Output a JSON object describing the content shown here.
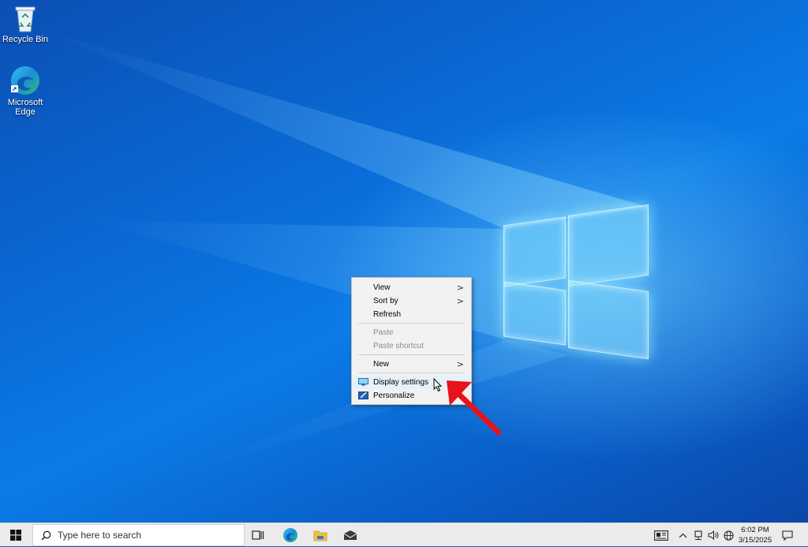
{
  "desktop": {
    "icons": [
      {
        "label": "Recycle Bin",
        "icon": "recycle-bin-icon"
      },
      {
        "label": "Microsoft Edge",
        "icon": "edge-icon"
      }
    ]
  },
  "context_menu": {
    "items": [
      {
        "label": "View",
        "submenu": true,
        "enabled": true
      },
      {
        "label": "Sort by",
        "submenu": true,
        "enabled": true
      },
      {
        "label": "Refresh",
        "submenu": false,
        "enabled": true
      },
      {
        "label": "Paste",
        "submenu": false,
        "enabled": false
      },
      {
        "label": "Paste shortcut",
        "submenu": false,
        "enabled": false
      },
      {
        "label": "New",
        "submenu": true,
        "enabled": true
      },
      {
        "label": "Display settings",
        "submenu": false,
        "enabled": true,
        "icon": "display-icon",
        "highlighted": true
      },
      {
        "label": "Personalize",
        "submenu": false,
        "enabled": true,
        "icon": "personalize-icon"
      }
    ],
    "submenu_glyph": ">"
  },
  "taskbar": {
    "search": {
      "placeholder": "Type here to search"
    },
    "pinned": [
      "task-view-icon",
      "edge-icon",
      "file-explorer-icon",
      "mail-icon"
    ],
    "tray": [
      "news-icon",
      "chevron-up-icon",
      "network-icon",
      "volume-icon",
      "globe-icon"
    ],
    "clock": {
      "time": "6:02 PM",
      "date": "3/15/2025"
    },
    "notifications": "action-center-icon"
  },
  "annotation": {
    "arrow_color": "#e8121b"
  }
}
